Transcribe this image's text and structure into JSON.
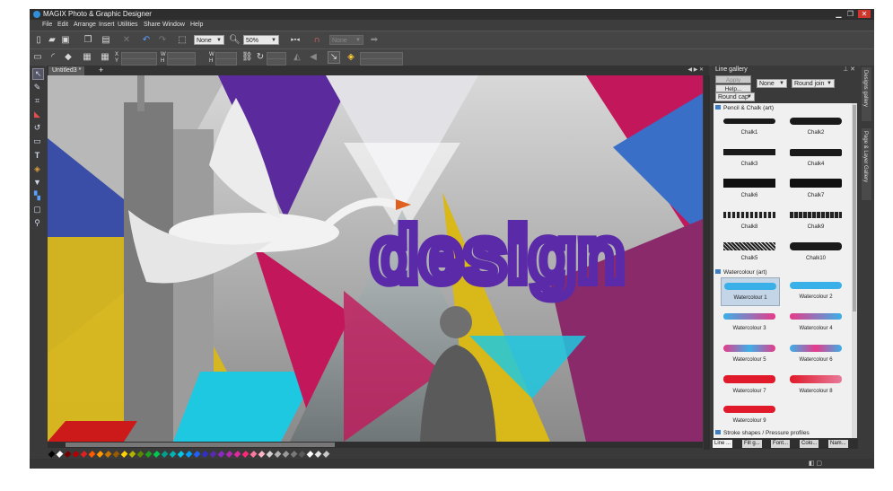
{
  "app": {
    "title": "MAGIX Photo & Graphic Designer"
  },
  "menu": [
    "File",
    "Edit",
    "Arrange",
    "Insert",
    "Utilities",
    "Share",
    "Window",
    "Help"
  ],
  "toolbar": {
    "fill_select": "None",
    "zoom_select": "50%",
    "disabled_select": "None"
  },
  "coords": {
    "x": "X",
    "y": "Y",
    "w": "W",
    "h": "H"
  },
  "document": {
    "tab_label": "Untitled3 *",
    "add_tab": "+",
    "canvas_word": "design"
  },
  "gallery": {
    "title": "Line gallery",
    "buttons": {
      "apply": "Apply",
      "help": "Help..."
    },
    "arrow_select": "None",
    "join_select": "Round join",
    "cap_select": "Round cap",
    "sections": [
      {
        "name": "Pencil & Chalk (art)",
        "items": [
          "Chalk1",
          "Chalk2",
          "Chalk3",
          "Chalk4",
          "Chalk6",
          "Chalk7",
          "Chalk8",
          "Chalk9",
          "Chalk5",
          "Chalk10"
        ]
      },
      {
        "name": "Watercolour (art)",
        "items": [
          "Watercolour 1",
          "Watercolour 2",
          "Watercolour 3",
          "Watercolour 4",
          "Watercolour 5",
          "Watercolour 6",
          "Watercolour 7",
          "Watercolour 8",
          "Watercolour 9"
        ]
      },
      {
        "name": "Stroke shapes / Pressure profiles",
        "items": []
      }
    ],
    "bottom_tabs": [
      "Line ...",
      "Fill g...",
      "Font...",
      "Colo...",
      "Nam..."
    ]
  },
  "side_tabs": [
    "Designs gallery",
    "Page & Layer Gallery"
  ],
  "colors": {
    "accent": "#3f7fc7",
    "purple": "#5b2a9c",
    "magenta": "#c2185b",
    "yellow": "#e2c200",
    "cyan": "#1ec8e0"
  },
  "palette": [
    "#000000",
    "#ffffff",
    "#7a0000",
    "#b00000",
    "#e02020",
    "#ff5a00",
    "#ff9a00",
    "#c87800",
    "#9a5a00",
    "#ffd200",
    "#b4b400",
    "#5a8a00",
    "#20a020",
    "#00c850",
    "#00a08a",
    "#00b4b4",
    "#00c8e6",
    "#00a0ff",
    "#2060ff",
    "#3030c8",
    "#5a2ab4",
    "#8c28c8",
    "#b428b4",
    "#e028a0",
    "#ff2878",
    "#ff78a0",
    "#ffb4c8",
    "#d2d2d2",
    "#b4b4b4",
    "#9a9a9a",
    "#7a7a7a",
    "#5a5a5a",
    "#ffffff",
    "#e6e6e6",
    "#c8c8c8"
  ]
}
